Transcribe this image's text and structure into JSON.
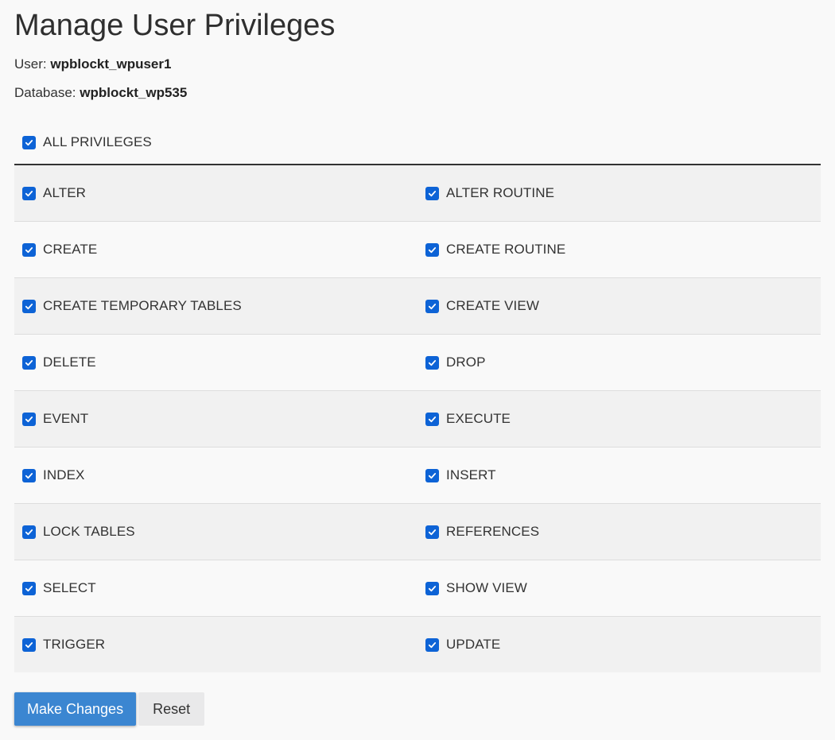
{
  "page": {
    "title": "Manage User Privileges",
    "user_label": "User:",
    "user_value": "wpblockt_wpuser1",
    "database_label": "Database:",
    "database_value": "wpblockt_wp535"
  },
  "all_privileges": {
    "label": "ALL PRIVILEGES",
    "checked": true
  },
  "privileges": [
    {
      "left": {
        "label": "ALTER",
        "checked": true
      },
      "right": {
        "label": "ALTER ROUTINE",
        "checked": true
      }
    },
    {
      "left": {
        "label": "CREATE",
        "checked": true
      },
      "right": {
        "label": "CREATE ROUTINE",
        "checked": true
      }
    },
    {
      "left": {
        "label": "CREATE TEMPORARY TABLES",
        "checked": true
      },
      "right": {
        "label": "CREATE VIEW",
        "checked": true
      }
    },
    {
      "left": {
        "label": "DELETE",
        "checked": true
      },
      "right": {
        "label": "DROP",
        "checked": true
      }
    },
    {
      "left": {
        "label": "EVENT",
        "checked": true
      },
      "right": {
        "label": "EXECUTE",
        "checked": true
      }
    },
    {
      "left": {
        "label": "INDEX",
        "checked": true
      },
      "right": {
        "label": "INSERT",
        "checked": true
      }
    },
    {
      "left": {
        "label": "LOCK TABLES",
        "checked": true
      },
      "right": {
        "label": "REFERENCES",
        "checked": true
      }
    },
    {
      "left": {
        "label": "SELECT",
        "checked": true
      },
      "right": {
        "label": "SHOW VIEW",
        "checked": true
      }
    },
    {
      "left": {
        "label": "TRIGGER",
        "checked": true
      },
      "right": {
        "label": "UPDATE",
        "checked": true
      }
    }
  ],
  "actions": {
    "make_changes": "Make Changes",
    "reset": "Reset"
  },
  "colors": {
    "checkbox": "#0d63d6",
    "primary_button": "#3b86d1"
  }
}
